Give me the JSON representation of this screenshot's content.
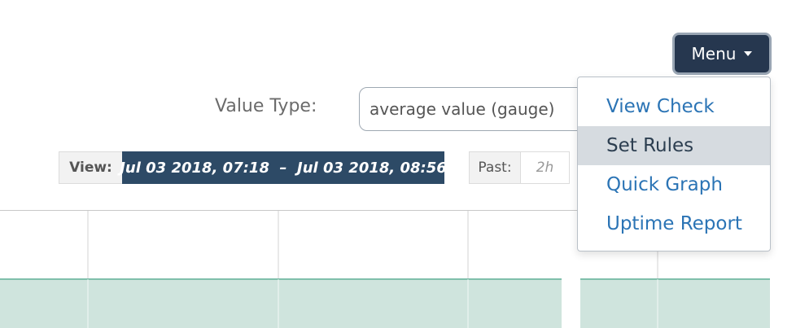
{
  "header": {
    "menu_label": "Menu"
  },
  "value_type": {
    "label": "Value Type:",
    "selected": "average value (gauge)"
  },
  "view": {
    "label": "View:",
    "range": "Jul 03 2018, 07:18  –  Jul 03 2018, 08:56",
    "past_label": "Past:",
    "past_option": "2h"
  },
  "dropdown": {
    "items": [
      {
        "label": "View Check"
      },
      {
        "label": "Set Rules"
      },
      {
        "label": "Quick Graph"
      },
      {
        "label": "Uptime Report"
      }
    ]
  },
  "colors": {
    "accent": "#26374f",
    "range_bg": "#2d4a66",
    "link": "#2b74b5",
    "chart_fill": "#cfe4dd",
    "chart_line": "#7fbfab"
  }
}
